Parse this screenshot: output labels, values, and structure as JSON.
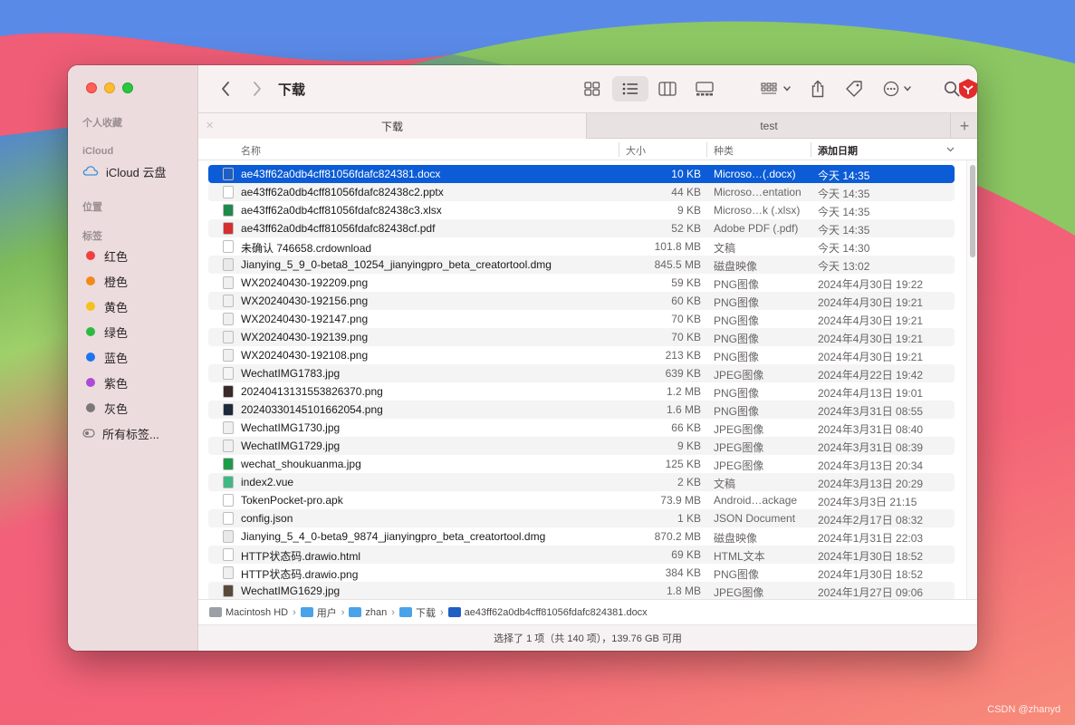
{
  "window": {
    "title": "下载"
  },
  "toolbar": {
    "title": "下载",
    "icons": [
      "chevron-left-icon",
      "chevron-right-icon",
      "grid-view-icon",
      "list-view-icon",
      "column-view-icon",
      "gallery-view-icon",
      "group-icon",
      "share-icon",
      "tag-icon",
      "more-icon",
      "security-app-icon",
      "search-icon"
    ]
  },
  "tabs": [
    {
      "label": "下载",
      "active": true
    },
    {
      "label": "test",
      "active": false
    }
  ],
  "sidebar": {
    "favorites_header": "个人收藏",
    "icloud_header": "iCloud",
    "icloud_drive": "iCloud 云盘",
    "locations_header": "位置",
    "tags_header": "标签",
    "tags": [
      {
        "label": "红色",
        "color": "#f23f3f"
      },
      {
        "label": "橙色",
        "color": "#f28a1a"
      },
      {
        "label": "黄色",
        "color": "#f5c11b"
      },
      {
        "label": "绿色",
        "color": "#2cbb42"
      },
      {
        "label": "蓝色",
        "color": "#1e74f0"
      },
      {
        "label": "紫色",
        "color": "#ac4bd6"
      },
      {
        "label": "灰色",
        "color": "#7c7778"
      }
    ],
    "all_tags": "所有标签..."
  },
  "columns": {
    "name": "名称",
    "size": "大小",
    "kind": "种类",
    "date": "添加日期"
  },
  "files": [
    {
      "name": "ae43ff62a0db4cff81056fdafc824381.docx",
      "size": "10 KB",
      "kind": "Microso…(.docx)",
      "date": "今天 14:35",
      "icon": "word-doc-icon",
      "icon_color": "#1f5fc4",
      "selected": true
    },
    {
      "name": "ae43ff62a0db4cff81056fdafc82438c2.pptx",
      "size": "44 KB",
      "kind": "Microso…entation",
      "date": "今天 14:35",
      "icon": "pptx-icon",
      "icon_color": "#ffffff"
    },
    {
      "name": "ae43ff62a0db4cff81056fdafc82438c3.xlsx",
      "size": "9 KB",
      "kind": "Microso…k (.xlsx)",
      "date": "今天 14:35",
      "icon": "excel-icon",
      "icon_color": "#1e8a4c"
    },
    {
      "name": "ae43ff62a0db4cff81056fdafc82438cf.pdf",
      "size": "52 KB",
      "kind": "Adobe PDF (.pdf)",
      "date": "今天 14:35",
      "icon": "pdf-icon",
      "icon_color": "#d62f2f"
    },
    {
      "name": "未确认 746658.crdownload",
      "size": "101.8 MB",
      "kind": "文稿",
      "date": "今天 14:30",
      "icon": "document-icon",
      "icon_color": "#ffffff"
    },
    {
      "name": "Jianying_5_9_0-beta8_10254_jianyingpro_beta_creatortool.dmg",
      "size": "845.5 MB",
      "kind": "磁盘映像",
      "date": "今天 13:02",
      "icon": "disk-image-icon",
      "icon_color": "#e9e9e9"
    },
    {
      "name": "WX20240430-192209.png",
      "size": "59 KB",
      "kind": "PNG图像",
      "date": "2024年4月30日 19:22",
      "icon": "image-icon",
      "icon_color": "#f0f0f0"
    },
    {
      "name": "WX20240430-192156.png",
      "size": "60 KB",
      "kind": "PNG图像",
      "date": "2024年4月30日 19:21",
      "icon": "image-icon",
      "icon_color": "#f0f0f0"
    },
    {
      "name": "WX20240430-192147.png",
      "size": "70 KB",
      "kind": "PNG图像",
      "date": "2024年4月30日 19:21",
      "icon": "image-icon",
      "icon_color": "#f0f0f0"
    },
    {
      "name": "WX20240430-192139.png",
      "size": "70 KB",
      "kind": "PNG图像",
      "date": "2024年4月30日 19:21",
      "icon": "image-icon",
      "icon_color": "#f0f0f0"
    },
    {
      "name": "WX20240430-192108.png",
      "size": "213 KB",
      "kind": "PNG图像",
      "date": "2024年4月30日 19:21",
      "icon": "image-icon",
      "icon_color": "#f0f0f0"
    },
    {
      "name": "WechatIMG1783.jpg",
      "size": "639 KB",
      "kind": "JPEG图像",
      "date": "2024年4月22日 19:42",
      "icon": "image-icon",
      "icon_color": "#f5f5f5"
    },
    {
      "name": "20240413131553826370.png",
      "size": "1.2 MB",
      "kind": "PNG图像",
      "date": "2024年4月13日 19:01",
      "icon": "image-icon",
      "icon_color": "#3a2a2a"
    },
    {
      "name": "20240330145101662054.png",
      "size": "1.6 MB",
      "kind": "PNG图像",
      "date": "2024年3月31日 08:55",
      "icon": "image-icon",
      "icon_color": "#1d2a3a"
    },
    {
      "name": "WechatIMG1730.jpg",
      "size": "66 KB",
      "kind": "JPEG图像",
      "date": "2024年3月31日 08:40",
      "icon": "image-icon",
      "icon_color": "#f0f0f0"
    },
    {
      "name": "WechatIMG1729.jpg",
      "size": "9 KB",
      "kind": "JPEG图像",
      "date": "2024年3月31日 08:39",
      "icon": "image-icon",
      "icon_color": "#f0f0f0"
    },
    {
      "name": "wechat_shoukuanma.jpg",
      "size": "125 KB",
      "kind": "JPEG图像",
      "date": "2024年3月13日 20:34",
      "icon": "qr-image-icon",
      "icon_color": "#1f9c4a"
    },
    {
      "name": "index2.vue",
      "size": "2 KB",
      "kind": "文稿",
      "date": "2024年3月13日 20:29",
      "icon": "vue-file-icon",
      "icon_color": "#41b883"
    },
    {
      "name": "TokenPocket-pro.apk",
      "size": "73.9 MB",
      "kind": "Android…ackage",
      "date": "2024年3月3日 21:15",
      "icon": "apk-icon",
      "icon_color": "#ffffff"
    },
    {
      "name": "config.json",
      "size": "1 KB",
      "kind": "JSON Document",
      "date": "2024年2月17日 08:32",
      "icon": "json-file-icon",
      "icon_color": "#ffffff"
    },
    {
      "name": "Jianying_5_4_0-beta9_9874_jianyingpro_beta_creatortool.dmg",
      "size": "870.2 MB",
      "kind": "磁盘映像",
      "date": "2024年1月31日 22:03",
      "icon": "disk-image-icon",
      "icon_color": "#e9e9e9"
    },
    {
      "name": "HTTP状态码.drawio.html",
      "size": "69 KB",
      "kind": "HTML文本",
      "date": "2024年1月30日 18:52",
      "icon": "html-file-icon",
      "icon_color": "#ffffff"
    },
    {
      "name": "HTTP状态码.drawio.png",
      "size": "384 KB",
      "kind": "PNG图像",
      "date": "2024年1月30日 18:52",
      "icon": "image-icon",
      "icon_color": "#f0f0f0"
    },
    {
      "name": "WechatIMG1629.jpg",
      "size": "1.8 MB",
      "kind": "JPEG图像",
      "date": "2024年1月27日 09:06",
      "icon": "image-icon",
      "icon_color": "#5a4a3a"
    }
  ],
  "pathbar": {
    "segments": [
      {
        "label": "Macintosh HD",
        "icon": "hard-drive-icon"
      },
      {
        "label": "用户",
        "icon": "folder-icon"
      },
      {
        "label": "zhan",
        "icon": "folder-icon"
      },
      {
        "label": "下载",
        "icon": "folder-icon"
      },
      {
        "label": "ae43ff62a0db4cff81056fdafc824381.docx",
        "icon": "word-doc-icon"
      }
    ],
    "separator": "›"
  },
  "status": {
    "text": "选择了 1 项（共 140 项），139.76 GB 可用"
  },
  "watermark": "CSDN @zhanyd"
}
